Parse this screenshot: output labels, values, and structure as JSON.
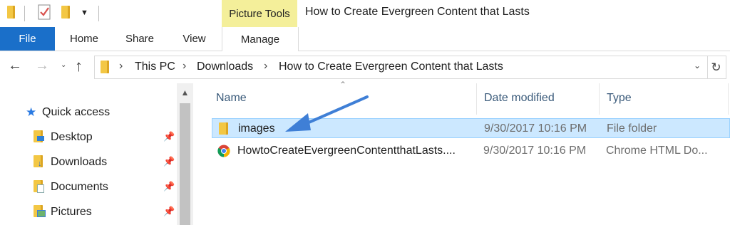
{
  "window": {
    "title": "How to Create Evergreen Content that Lasts",
    "context_tab": "Picture Tools"
  },
  "ribbon": {
    "tabs": [
      "File",
      "Home",
      "Share",
      "View",
      "Manage"
    ]
  },
  "address": {
    "crumbs": [
      "This PC",
      "Downloads",
      "How to Create Evergreen Content that Lasts"
    ]
  },
  "nav_pane": {
    "quick_access": "Quick access",
    "items": [
      {
        "label": "Desktop",
        "icon": "desktop-folder-icon"
      },
      {
        "label": "Downloads",
        "icon": "downloads-folder-icon"
      },
      {
        "label": "Documents",
        "icon": "documents-folder-icon"
      },
      {
        "label": "Pictures",
        "icon": "pictures-folder-icon"
      }
    ]
  },
  "columns": {
    "name": "Name",
    "date": "Date modified",
    "type": "Type"
  },
  "files": [
    {
      "name": "images",
      "date": "9/30/2017 10:16 PM",
      "type": "File folder",
      "icon": "folder-icon",
      "selected": true
    },
    {
      "name": "HowtoCreateEvergreenContentthatLasts....",
      "date": "9/30/2017 10:16 PM",
      "type": "Chrome HTML Do...",
      "icon": "chrome-icon",
      "selected": false
    }
  ],
  "colors": {
    "file_tab": "#1a6fc9",
    "context_tab": "#f4ef9a",
    "selection": "#cce8ff",
    "annotation_arrow": "#3f7fd6"
  }
}
